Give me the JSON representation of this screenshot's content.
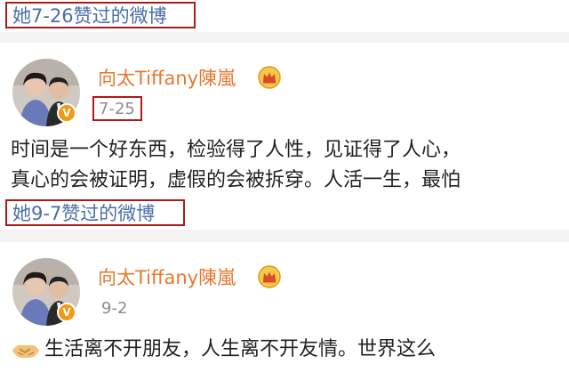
{
  "top_label": {
    "text": "她7-26赞过的微博"
  },
  "post1": {
    "username": "向太Tiffany陳嵐",
    "date": "7-25",
    "lines": [
      "时间是一个好东西，检验得了人性，见证得了人心，",
      "真心的会被证明，虚假的会被拆穿。人活一生，最怕"
    ]
  },
  "mid_label": {
    "text": "她9-7赞过的微博"
  },
  "post2": {
    "username": "向太Tiffany陳嵐",
    "date": "9-2",
    "lines": [
      "生活离不开朋友，人生离不开友情。世界这么"
    ]
  },
  "icons": {
    "verified": "verified-badge-icon",
    "crown": "crown-icon",
    "handshake": "handshake-emoji-icon"
  },
  "colors": {
    "username": "#e8772e",
    "highlight_border": "#b11919",
    "label_text": "#4a6ea8",
    "meta": "#8c8c8c"
  }
}
